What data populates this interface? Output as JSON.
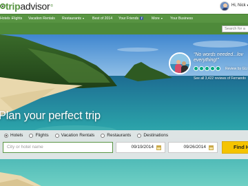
{
  "header": {
    "logo": {
      "primary": "trip",
      "secondary": "advisor"
    },
    "user": {
      "greeting": "Hi, Nick"
    }
  },
  "nav": {
    "items": [
      {
        "label": "Hotels",
        "has_caret": true
      },
      {
        "label": "Flights",
        "has_caret": false
      },
      {
        "label": "Vacation Rentals",
        "has_caret": false
      },
      {
        "label": "Restaurants",
        "has_caret": true
      },
      {
        "label": "Best of 2014",
        "has_caret": false
      },
      {
        "label": "Your Friends",
        "badge": "f"
      },
      {
        "label": "More",
        "has_caret": true
      },
      {
        "label": "Your Business",
        "has_caret": false
      }
    ],
    "site_search_placeholder": "Search for a"
  },
  "hero": {
    "headline": "Plan your perfect trip",
    "review": {
      "quote_line1": "“No words needed...lov",
      "quote_line2": "everything!”",
      "rating": 5,
      "review_by": "Review by GLi",
      "see_all": "See all 3,422 reviews of Fernando"
    }
  },
  "search": {
    "types": [
      {
        "label": "Hotels",
        "selected": true
      },
      {
        "label": "Flights",
        "selected": false
      },
      {
        "label": "Vacation Rentals",
        "selected": false
      },
      {
        "label": "Restaurants",
        "selected": false
      },
      {
        "label": "Destinations",
        "selected": false
      }
    ],
    "destination_placeholder": "City or hotel name",
    "check_in": "09/19/2014",
    "check_out": "09/26/2014",
    "submit_label": "Find H"
  },
  "colors": {
    "brand_green": "#589442",
    "find_button": "#f5c400",
    "rating_green": "#00a680"
  }
}
